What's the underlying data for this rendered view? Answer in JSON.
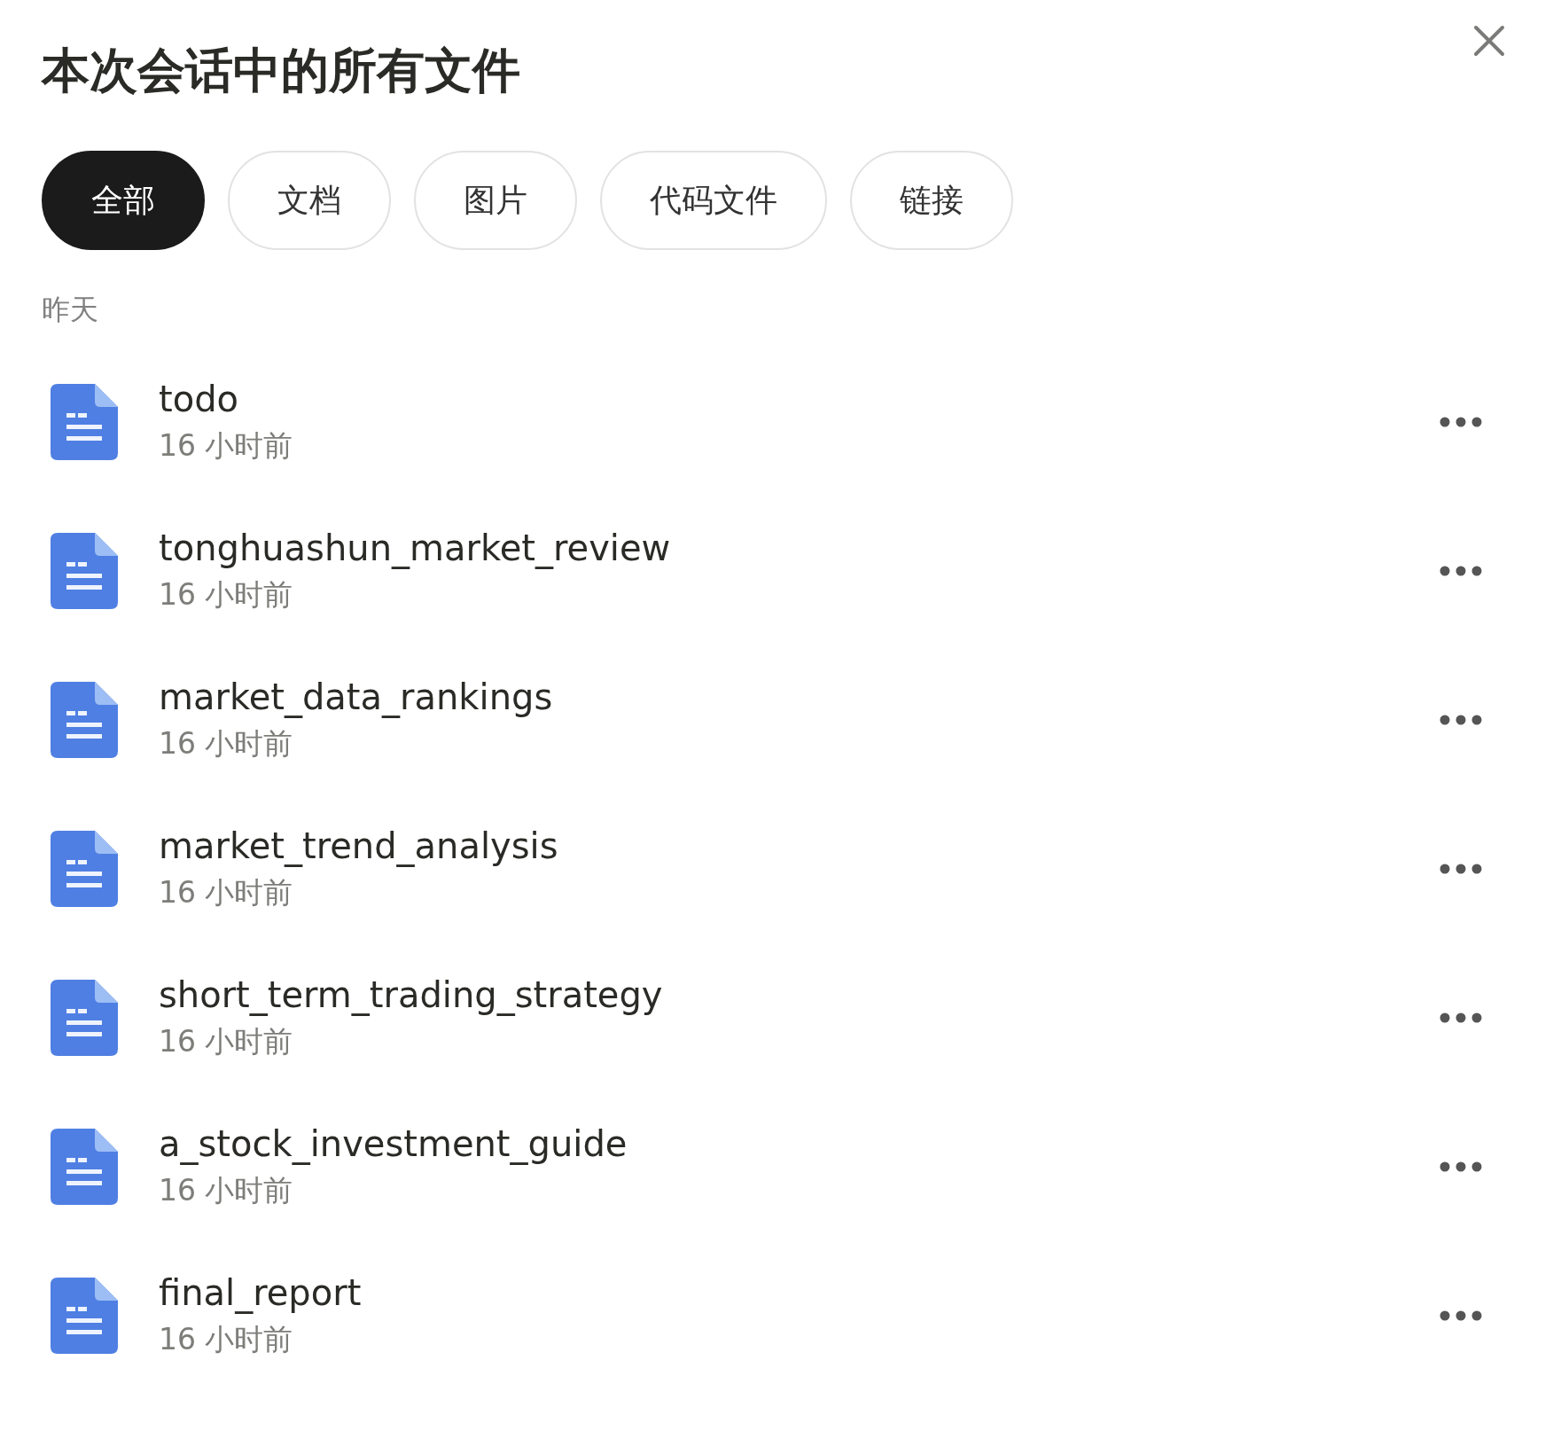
{
  "dialog": {
    "title": "本次会话中的所有文件"
  },
  "tabs": [
    {
      "label": "全部",
      "selected": true
    },
    {
      "label": "文档",
      "selected": false
    },
    {
      "label": "图片",
      "selected": false
    },
    {
      "label": "代码文件",
      "selected": false
    },
    {
      "label": "链接",
      "selected": false
    }
  ],
  "section": "昨天",
  "files": [
    {
      "name": "todo",
      "time": "16 小时前"
    },
    {
      "name": "tonghuashun_market_review",
      "time": "16 小时前"
    },
    {
      "name": "market_data_rankings",
      "time": "16 小时前"
    },
    {
      "name": "market_trend_analysis",
      "time": "16 小时前"
    },
    {
      "name": "short_term_trading_strategy",
      "time": "16 小时前"
    },
    {
      "name": "a_stock_investment_guide",
      "time": "16 小时前"
    },
    {
      "name": "final_report",
      "time": "16 小时前"
    }
  ]
}
